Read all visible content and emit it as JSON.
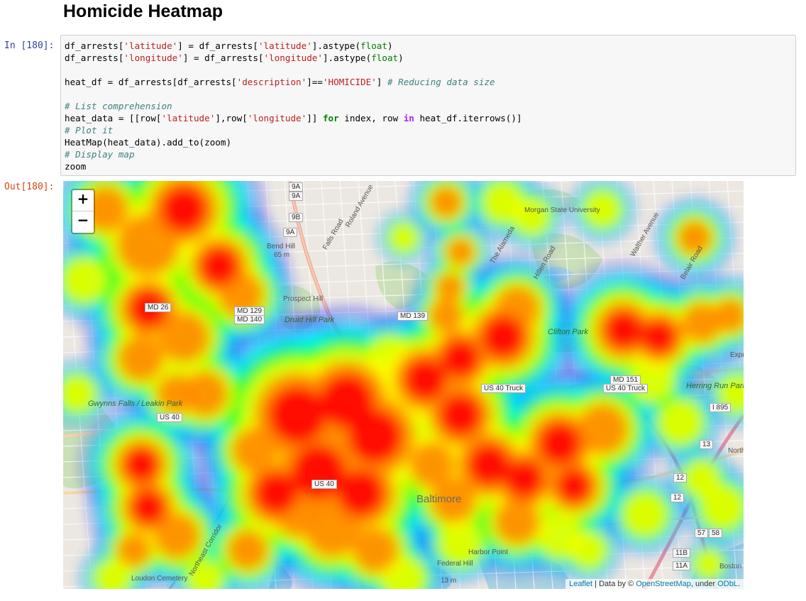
{
  "page": {
    "title": "Homicide Heatmap"
  },
  "input_cell": {
    "prompt": "In [180]:",
    "code": [
      [
        [
          "df_arrests[",
          ""
        ],
        [
          "'latitude'",
          "str"
        ],
        [
          "] = df_arrests[",
          ""
        ],
        [
          "'latitude'",
          "str"
        ],
        [
          "].astype(",
          ""
        ],
        [
          "float",
          "bi"
        ],
        [
          ")",
          ""
        ]
      ],
      [
        [
          "df_arrests[",
          ""
        ],
        [
          "'longitude'",
          "str"
        ],
        [
          "] = df_arrests[",
          ""
        ],
        [
          "'longitude'",
          "str"
        ],
        [
          "].astype(",
          ""
        ],
        [
          "float",
          "bi"
        ],
        [
          ")",
          ""
        ]
      ],
      [],
      [
        [
          "heat_df = df_arrests[df_arrests[",
          ""
        ],
        [
          "'description'",
          "str"
        ],
        [
          "]==",
          ""
        ],
        [
          "'HOMICIDE'",
          "str"
        ],
        [
          "] ",
          ""
        ],
        [
          "# Reducing data size",
          "cm"
        ]
      ],
      [],
      [
        [
          "# List comprehension",
          "cm"
        ]
      ],
      [
        [
          "heat_data = [[row[",
          ""
        ],
        [
          "'latitude'",
          "str"
        ],
        [
          "],row[",
          ""
        ],
        [
          "'longitude'",
          "str"
        ],
        [
          "]] ",
          ""
        ],
        [
          "for",
          "kw"
        ],
        [
          " index, row ",
          ""
        ],
        [
          "in",
          "op"
        ],
        [
          " heat_df.iterrows()]",
          ""
        ]
      ],
      [
        [
          "# Plot it",
          "cm"
        ]
      ],
      [
        [
          "HeatMap(heat_data).add_to(zoom)",
          ""
        ]
      ],
      [
        [
          "# Display map",
          "cm"
        ]
      ],
      [
        [
          "zoom",
          ""
        ]
      ]
    ]
  },
  "output_cell": {
    "prompt": "Out[180]:",
    "map": {
      "zoom_in": "+",
      "zoom_out": "−",
      "attribution": {
        "leaflet": "Leaflet",
        "data_by": " | Data by © ",
        "osm": "OpenStreetMap",
        "under": ", under ",
        "odbl": "ODbL",
        "end": "."
      },
      "labels": [
        {
          "text": "Bend Hill",
          "type": "plain"
        },
        {
          "text": "65 m",
          "type": "plain"
        },
        {
          "text": "Prospect Hill",
          "type": "plain"
        },
        {
          "text": "Druid Hill Park",
          "type": "park"
        },
        {
          "text": "Morgan State University",
          "type": "plain"
        },
        {
          "text": "Clifton Park",
          "type": "park"
        },
        {
          "text": "Herring Run Park",
          "type": "park"
        },
        {
          "text": "Gwynns Falls / Leakin Park",
          "type": "park"
        },
        {
          "text": "Baltimore",
          "type": "city"
        },
        {
          "text": "Harbor Point",
          "type": "plain"
        },
        {
          "text": "Federal Hill",
          "type": "plain"
        },
        {
          "text": "13 m",
          "type": "plain"
        },
        {
          "text": "Roland Avenue",
          "type": "plain"
        },
        {
          "text": "Falls Road",
          "type": "plain"
        },
        {
          "text": "The Alameda",
          "type": "plain"
        },
        {
          "text": "Hillen Road",
          "type": "plain"
        },
        {
          "text": "Walther Avenue",
          "type": "plain"
        },
        {
          "text": "Belair Road",
          "type": "plain"
        },
        {
          "text": "Northeast Corridor",
          "type": "plain"
        },
        {
          "text": "Loudon Cemetery",
          "type": "plain"
        },
        {
          "text": "Boston",
          "type": "plain"
        },
        {
          "text": "Expre",
          "type": "plain"
        },
        {
          "text": "North",
          "type": "plain"
        }
      ],
      "shields": [
        "9A",
        "9A",
        "9B",
        "9A",
        "MD 26",
        "MD 129",
        "MD 140",
        "MD 139",
        "MD 151",
        "US 40 Truck",
        "US 40 Truck",
        "US 40",
        "I 895",
        "US 40",
        "13",
        "12",
        "12",
        "57",
        "58",
        "11B",
        "11A"
      ],
      "heat_colors": [
        "#0000ff",
        "#00ffff",
        "#00ff00",
        "#ffff00",
        "#ff8800",
        "#ff0000"
      ]
    }
  }
}
